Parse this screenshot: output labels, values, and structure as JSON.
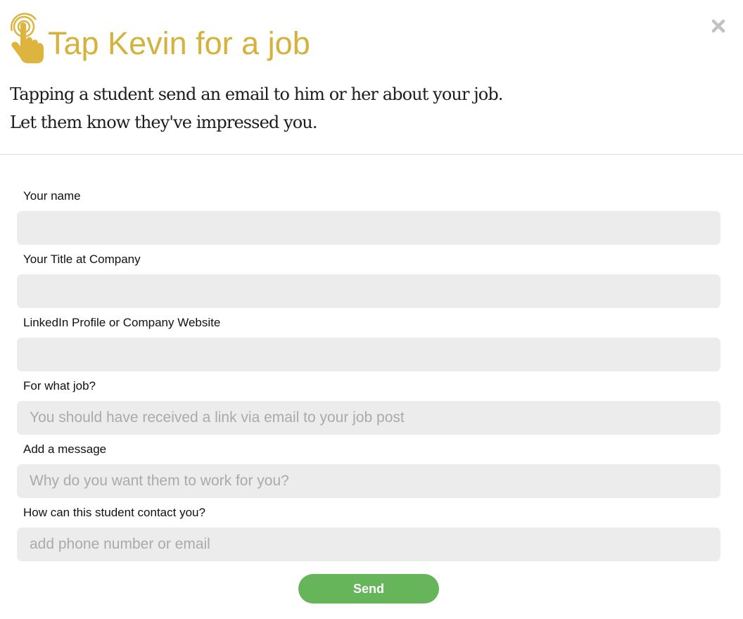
{
  "colors": {
    "title": "#d4b23c",
    "icon": "#dcb43e",
    "close": "#c2c2c2",
    "send_button": "#67b55a",
    "input_bg": "#ececec"
  },
  "header": {
    "icon": "tap-finger-icon",
    "title": "Tap Kevin for a job",
    "subtitle_line1": "Tapping a student send an email to him or her about your job.",
    "subtitle_line2": "Let them know they've impressed you.",
    "close_icon": "close-icon"
  },
  "form": {
    "fields": [
      {
        "label": "Your name",
        "value": "",
        "placeholder": ""
      },
      {
        "label": "Your Title at Company",
        "value": "",
        "placeholder": ""
      },
      {
        "label": "LinkedIn Profile or Company Website",
        "value": "",
        "placeholder": ""
      },
      {
        "label": "For what job?",
        "value": "",
        "placeholder": "You should have received a link via email to your job post"
      },
      {
        "label": "Add a message",
        "value": "",
        "placeholder": "Why do you want them to work for you?"
      },
      {
        "label": "How can this student contact you?",
        "value": "",
        "placeholder": "add phone number or email"
      }
    ],
    "send_label": "Send"
  }
}
